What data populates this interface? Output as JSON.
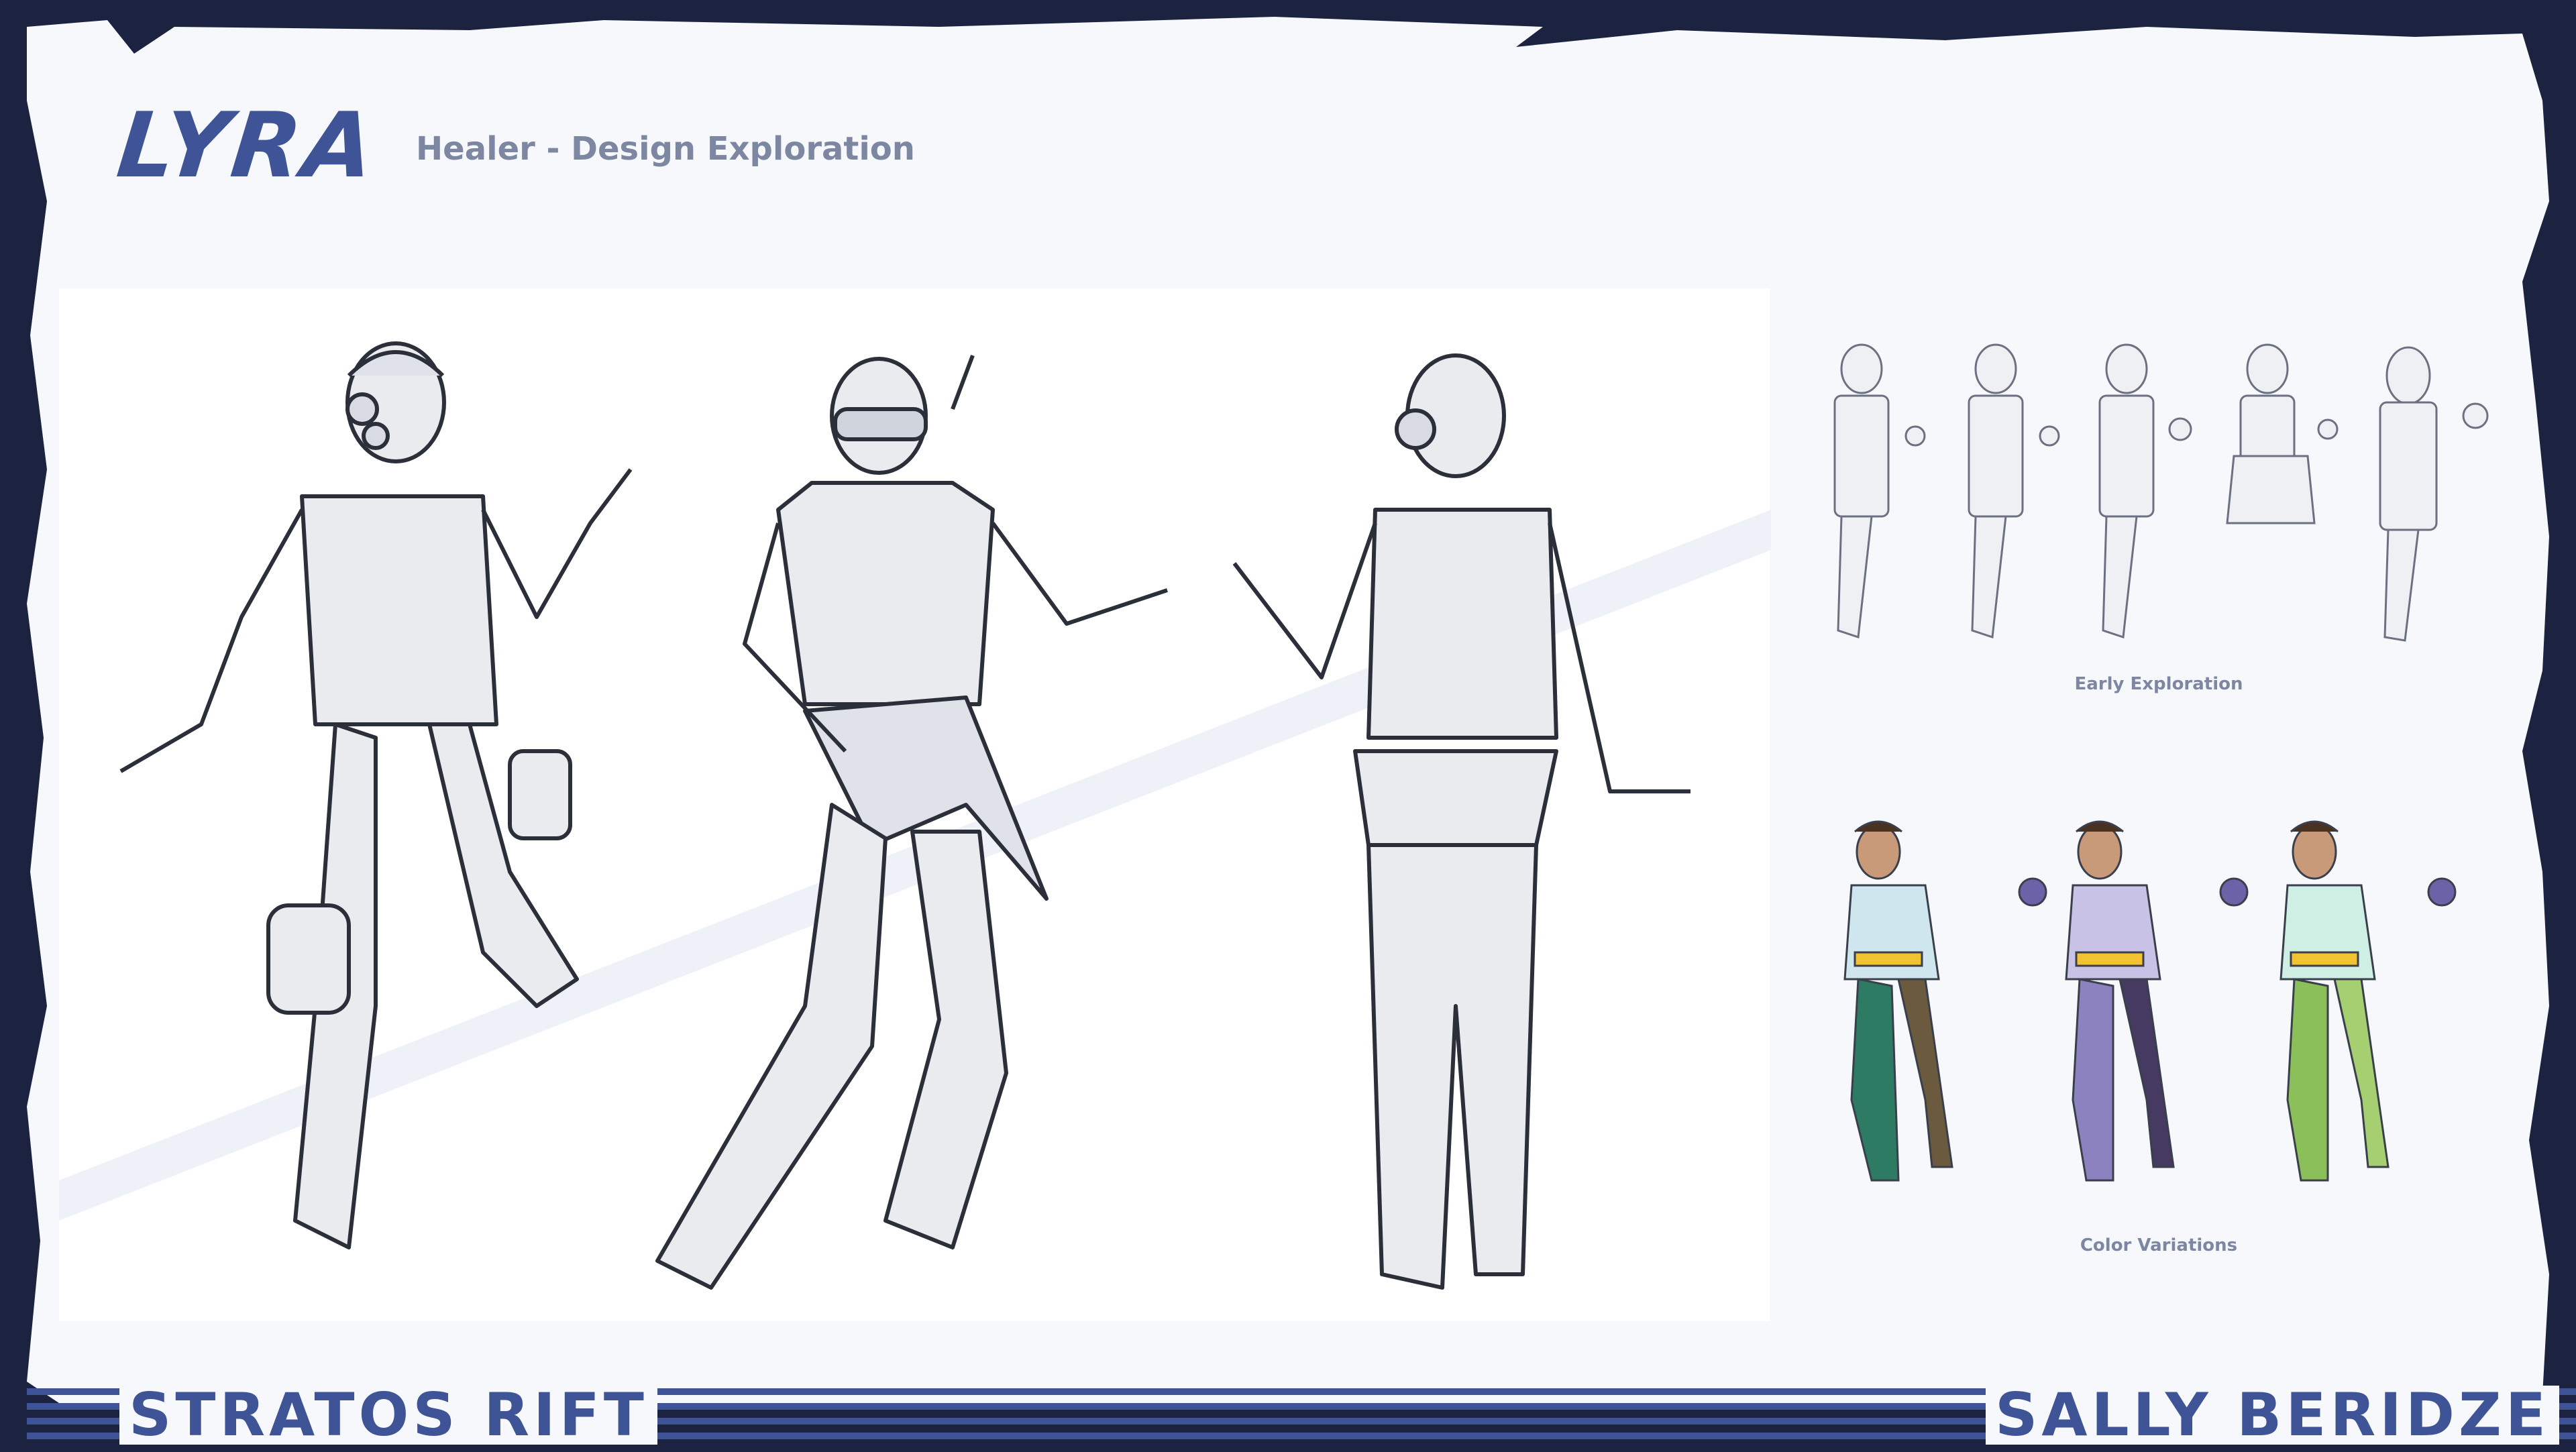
{
  "header": {
    "title": "LYRA",
    "subtitle": "Healer - Design Exploration"
  },
  "thumbnails": {
    "early_label": "Early Exploration",
    "color_label": "Color Variations"
  },
  "footer": {
    "left_brand": "STRATOS RIFT",
    "right_brand": "SALLY BERIDZE"
  },
  "colors": {
    "frame": "#1b2341",
    "paper": "#f6f8fc",
    "accent": "#3e5496",
    "muted_text": "#7d87a1",
    "variant_teal": "#2e7b63",
    "variant_violet": "#8c82c0",
    "variant_green": "#8bbf5a",
    "sash_yellow": "#f2c230"
  }
}
